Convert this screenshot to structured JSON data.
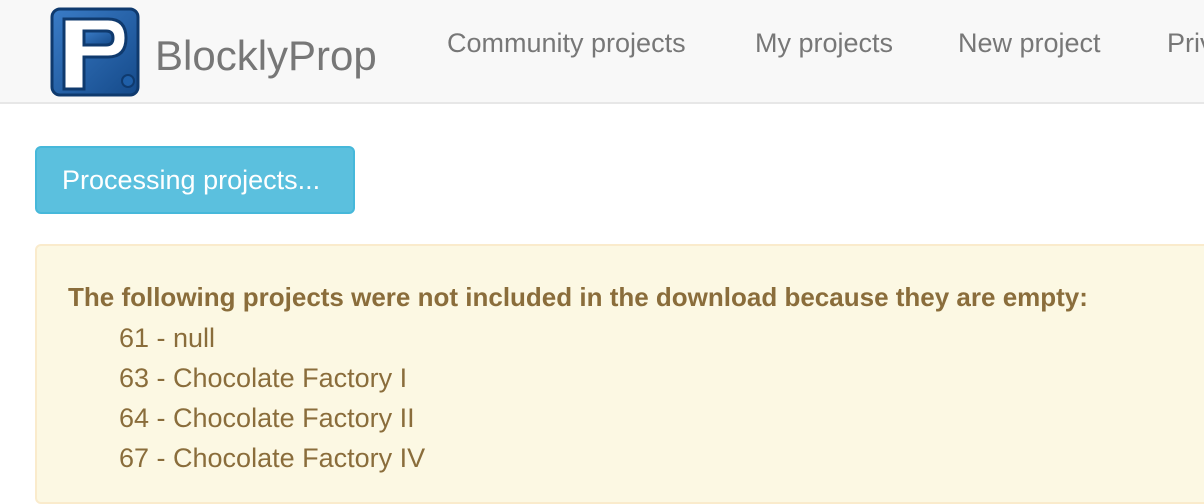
{
  "header": {
    "brand": "BlocklyProp",
    "nav": [
      {
        "label": "Community projects"
      },
      {
        "label": "My projects"
      },
      {
        "label": "New project"
      },
      {
        "label": "Priv"
      }
    ]
  },
  "main": {
    "processing_button": "Processing projects...",
    "alert": {
      "title": "The following projects were not included in the download because they are empty:",
      "items": [
        "61 - null",
        "63 - Chocolate Factory I",
        "64 - Chocolate Factory II",
        "67 - Chocolate Factory IV"
      ]
    }
  },
  "colors": {
    "info_button": "#5bc0de",
    "warning_bg": "#fcf8e3",
    "warning_text": "#8a6d3b",
    "logo_blue": "#1f5fa8"
  },
  "icons": {
    "logo": "blocklyprop-logo-icon"
  }
}
